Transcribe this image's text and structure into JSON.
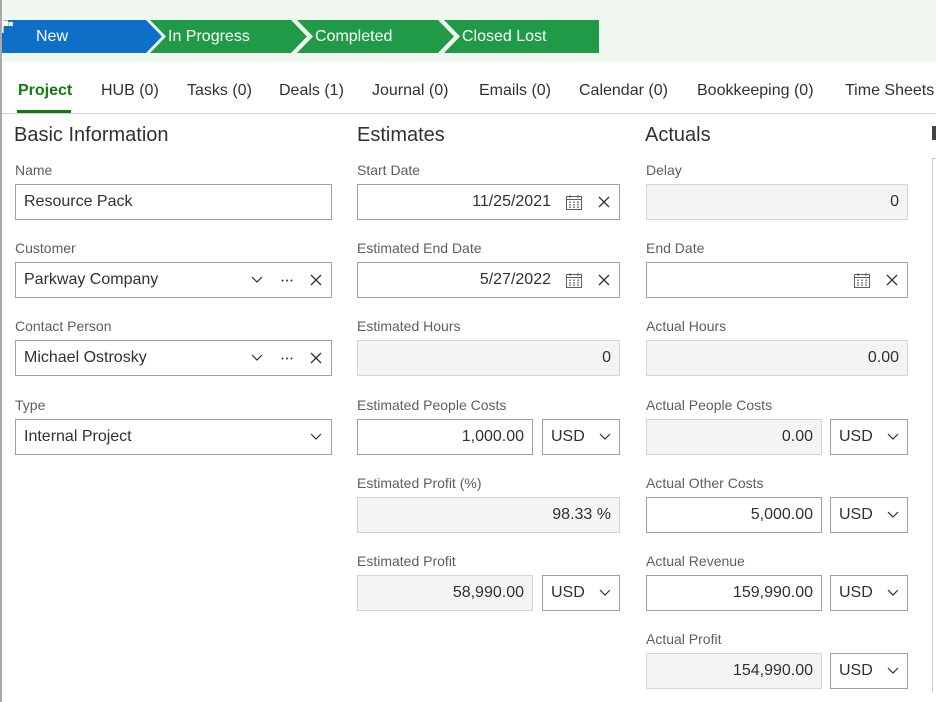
{
  "status_bar": {
    "stages": [
      {
        "label": "New",
        "state": "current",
        "color": "#0e6fc7",
        "icon": "flag-icon"
      },
      {
        "label": "In Progress",
        "state": "pending",
        "color": "#219a47"
      },
      {
        "label": "Completed",
        "state": "pending",
        "color": "#219a47"
      },
      {
        "label": "Closed Lost",
        "state": "pending",
        "color": "#219a47"
      }
    ]
  },
  "tabs": [
    {
      "label": "Project",
      "active": true
    },
    {
      "label": "HUB (0)"
    },
    {
      "label": "Tasks (0)"
    },
    {
      "label": "Deals (1)"
    },
    {
      "label": "Journal (0)"
    },
    {
      "label": "Emails (0)"
    },
    {
      "label": "Calendar (0)"
    },
    {
      "label": "Bookkeeping (0)"
    },
    {
      "label": "Time Sheets"
    }
  ],
  "accent_color": "#107c10",
  "basic_info": {
    "title": "Basic Information",
    "name": {
      "label": "Name",
      "value": "Resource Pack"
    },
    "customer": {
      "label": "Customer",
      "value": "Parkway Company"
    },
    "contact_person": {
      "label": "Contact Person",
      "value": "Michael Ostrosky"
    },
    "type": {
      "label": "Type",
      "value": "Internal Project"
    }
  },
  "estimates": {
    "title": "Estimates",
    "start_date": {
      "label": "Start Date",
      "value": "11/25/2021"
    },
    "end_date": {
      "label": "Estimated End Date",
      "value": "5/27/2022"
    },
    "hours": {
      "label": "Estimated Hours",
      "value": "0"
    },
    "people_costs": {
      "label": "Estimated People Costs",
      "value": "1,000.00",
      "currency": "USD"
    },
    "profit_pct": {
      "label": "Estimated Profit (%)",
      "value": "98.33 %"
    },
    "profit": {
      "label": "Estimated Profit",
      "value": "58,990.00",
      "currency": "USD"
    }
  },
  "actuals": {
    "title": "Actuals",
    "delay": {
      "label": "Delay",
      "value": "0"
    },
    "end_date": {
      "label": "End Date",
      "value": ""
    },
    "hours": {
      "label": "Actual Hours",
      "value": "0.00"
    },
    "people_costs": {
      "label": "Actual People Costs",
      "value": "0.00",
      "currency": "USD"
    },
    "other_costs": {
      "label": "Actual Other Costs",
      "value": "5,000.00",
      "currency": "USD"
    },
    "revenue": {
      "label": "Actual Revenue",
      "value": "159,990.00",
      "currency": "USD"
    },
    "profit": {
      "label": "Actual Profit",
      "value": "154,990.00",
      "currency": "USD"
    }
  }
}
